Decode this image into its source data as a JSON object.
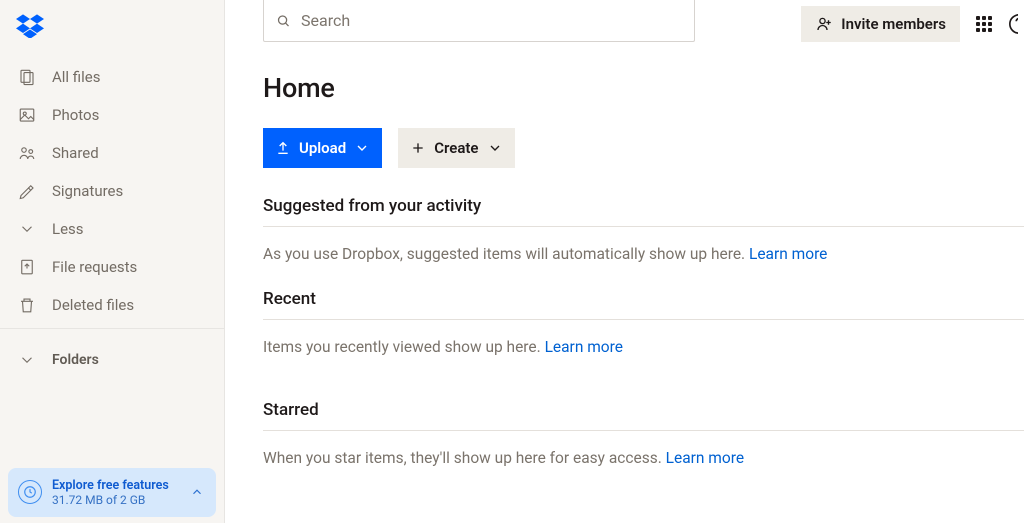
{
  "sidebar": {
    "items": [
      {
        "label": "All files",
        "icon": "files-icon"
      },
      {
        "label": "Photos",
        "icon": "photo-icon"
      },
      {
        "label": "Shared",
        "icon": "shared-icon"
      },
      {
        "label": "Signatures",
        "icon": "signature-icon"
      },
      {
        "label": "Less",
        "icon": "chevron-down-icon"
      },
      {
        "label": "File requests",
        "icon": "file-request-icon"
      },
      {
        "label": "Deleted files",
        "icon": "trash-icon"
      }
    ],
    "folders_label": "Folders"
  },
  "promo": {
    "title": "Explore free features",
    "subtitle": "31.72 MB of 2 GB"
  },
  "search": {
    "placeholder": "Search"
  },
  "topright": {
    "invite_label": "Invite members"
  },
  "page": {
    "title": "Home"
  },
  "actions": {
    "upload_label": "Upload",
    "create_label": "Create"
  },
  "sections": {
    "suggested": {
      "heading": "Suggested from your activity",
      "message": "As you use Dropbox, suggested items will automatically show up here. ",
      "link": "Learn more"
    },
    "recent": {
      "heading": "Recent",
      "message": "Items you recently viewed show up here. ",
      "link": "Learn more"
    },
    "starred": {
      "heading": "Starred",
      "message": "When you star items, they'll show up here for easy access. ",
      "link": "Learn more"
    }
  }
}
